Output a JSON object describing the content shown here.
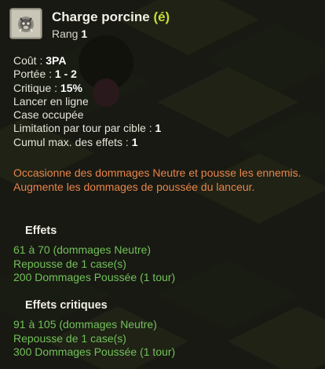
{
  "spell": {
    "name": "Charge porcine",
    "suffix": "(é)",
    "rank_label": "Rang",
    "rank_value": "1",
    "icon": "boar-head-icon"
  },
  "stats": [
    {
      "label": "Coût : ",
      "value": "3PA"
    },
    {
      "label": "Portée : ",
      "value": "1 - 2"
    },
    {
      "label": "Critique : ",
      "value": "15%"
    },
    {
      "label": "Lancer en ligne",
      "value": ""
    },
    {
      "label": "Case occupée",
      "value": ""
    },
    {
      "label": "Limitation par tour par cible : ",
      "value": "1"
    },
    {
      "label": "Cumul max. des effets : ",
      "value": "1"
    }
  ],
  "description": [
    "Occasionne des dommages Neutre et pousse les ennemis.",
    "Augmente les dommages de poussée du lanceur."
  ],
  "effects": {
    "title": "Effets",
    "items": [
      "61 à 70 (dommages Neutre)",
      "Repousse de 1 case(s)",
      "200 Dommages Poussée (1 tour)"
    ]
  },
  "critical_effects": {
    "title": "Effets critiques",
    "items": [
      "91 à 105 (dommages Neutre)",
      "Repousse de 1 case(s)",
      "300 Dommages Poussée (1 tour)"
    ]
  },
  "colors": {
    "suffix": "#c8dc3a",
    "description": "#e8844b",
    "effect_text": "#72c05a"
  }
}
